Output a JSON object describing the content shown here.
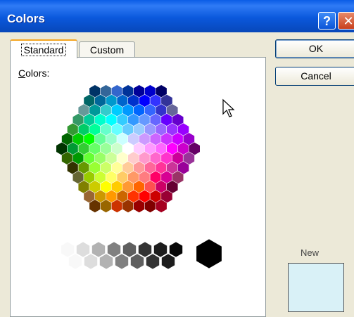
{
  "window": {
    "title": "Colors",
    "help_glyph": "?",
    "close_glyph": "✕"
  },
  "tabs": [
    {
      "label": "Standard",
      "active": true
    },
    {
      "label": "Custom",
      "active": false
    }
  ],
  "colors_label": {
    "mnemonic": "C",
    "rest": "olors:"
  },
  "buttons": {
    "ok": "OK",
    "cancel": "Cancel"
  },
  "preview": {
    "new_label": "New",
    "new_color": "#d9f1f7"
  },
  "palette": {
    "rows": [
      [
        "#003366",
        "#336699",
        "#3366cc",
        "#003399",
        "#000099",
        "#0000cc",
        "#000066"
      ],
      [
        "#006666",
        "#006699",
        "#0099cc",
        "#0066cc",
        "#0033cc",
        "#0000ff",
        "#3333ff",
        "#333399"
      ],
      [
        "#669999",
        "#009999",
        "#33cccc",
        "#00ccff",
        "#0099ff",
        "#0066ff",
        "#3366ff",
        "#3333cc",
        "#666699"
      ],
      [
        "#339966",
        "#00cc99",
        "#00ffcc",
        "#00ffff",
        "#33ccff",
        "#3399ff",
        "#6699ff",
        "#6666ff",
        "#6600ff",
        "#6600cc"
      ],
      [
        "#339933",
        "#00cc66",
        "#00ff99",
        "#66ffcc",
        "#66ffff",
        "#66ccff",
        "#99ccff",
        "#9999ff",
        "#9966ff",
        "#9933ff",
        "#9900ff"
      ],
      [
        "#006600",
        "#00cc00",
        "#00ff00",
        "#66ff99",
        "#99ffcc",
        "#ccffff",
        "#ccccff",
        "#cc99ff",
        "#cc66ff",
        "#cc33ff",
        "#cc00ff",
        "#9900cc"
      ],
      [
        "#003300",
        "#009933",
        "#33cc33",
        "#66ff66",
        "#99ff99",
        "#ccffcc",
        "#ffffff",
        "#ffccff",
        "#ff99ff",
        "#ff66ff",
        "#ff00ff",
        "#cc00cc",
        "#660066"
      ],
      [
        "#336600",
        "#009900",
        "#66ff33",
        "#99ff66",
        "#ccff99",
        "#ffffcc",
        "#ffcccc",
        "#ff99cc",
        "#ff66cc",
        "#ff33cc",
        "#cc0099",
        "#993399"
      ],
      [
        "#333300",
        "#669900",
        "#99ff33",
        "#ccff66",
        "#ffff99",
        "#ffcc99",
        "#ff9999",
        "#ff6699",
        "#ff3399",
        "#cc3399",
        "#990099"
      ],
      [
        "#666633",
        "#99cc00",
        "#ccff33",
        "#ffff66",
        "#ffcc66",
        "#ff9966",
        "#ff7c80",
        "#ff0066",
        "#d60093",
        "#993366"
      ],
      [
        "#808000",
        "#cccc00",
        "#ffff00",
        "#ffcc00",
        "#ff9933",
        "#ff6600",
        "#ff5050",
        "#cc0066",
        "#660033"
      ],
      [
        "#996633",
        "#cc9900",
        "#ff9900",
        "#cc6600",
        "#ff3300",
        "#ff0000",
        "#cc0000",
        "#990033"
      ],
      [
        "#663300",
        "#996600",
        "#cc3300",
        "#993300",
        "#990000",
        "#800000",
        "#a50021"
      ]
    ],
    "grays": [
      "#f8f8f8",
      "#dddddd",
      "#b2b2b2",
      "#808080",
      "#5f5f5f",
      "#333333",
      "#1c1c1c",
      "#080808"
    ],
    "white_large": "#ffffff",
    "black_large": "#000000"
  }
}
